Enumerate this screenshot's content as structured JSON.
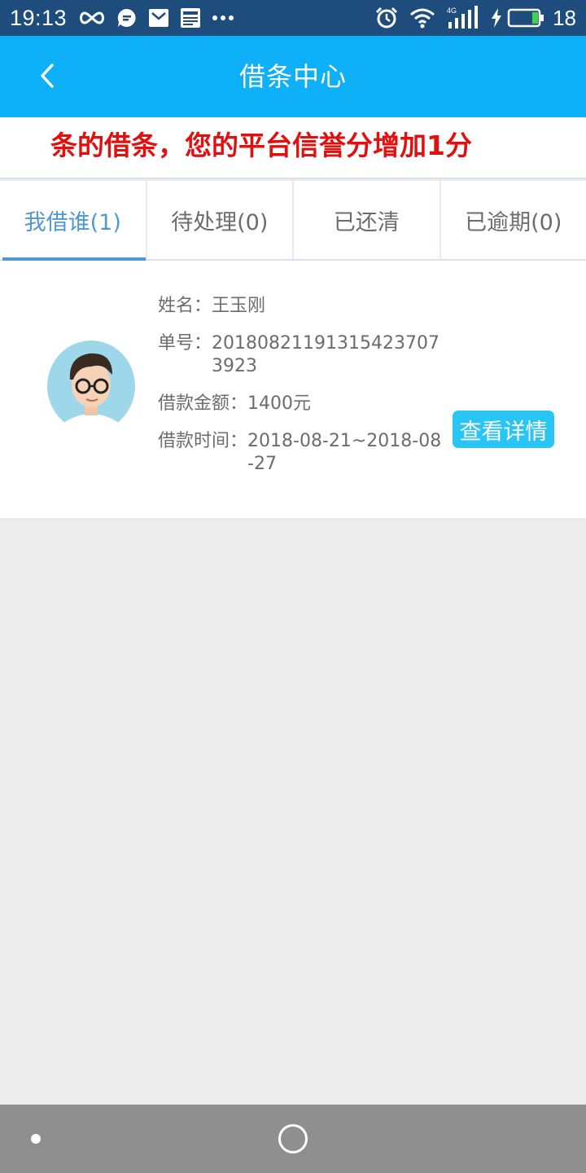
{
  "status_bar": {
    "time": "19:13",
    "battery_level": "18",
    "network": "4G",
    "icons": [
      "infinity-icon",
      "chat-bubble-icon",
      "envelope-icon",
      "news-icon",
      "more-dots-icon",
      "alarm-icon",
      "wifi-icon",
      "signal-icon",
      "charging-icon",
      "battery-icon"
    ]
  },
  "header": {
    "title": "借条中心",
    "back_icon": "chevron-left-icon"
  },
  "marquee": {
    "text": "条的借条，您的平台信誉分增加1分",
    "color": "#e20f0f"
  },
  "tabs": [
    {
      "label": "我借谁(1)",
      "active": true
    },
    {
      "label": "待处理(0)",
      "active": false
    },
    {
      "label": "已还清",
      "active": false
    },
    {
      "label": "已逾期(0)",
      "active": false
    }
  ],
  "loan": {
    "name_label": "姓名：",
    "name": "王玉刚",
    "order_label": "单号：",
    "order_no": "20180821191315423707 3923",
    "amount_label": "借款金额：",
    "amount": "1400元",
    "date_label": "借款时间：",
    "date_range": "2018-08-21~2018-08-27",
    "detail_button": "查看详情"
  },
  "colors": {
    "status_bar": "#1e4d7d",
    "header": "#0eb0f8",
    "tab_active": "#4f97d6",
    "button": "#29c5f5",
    "page_bg": "#ececec"
  }
}
